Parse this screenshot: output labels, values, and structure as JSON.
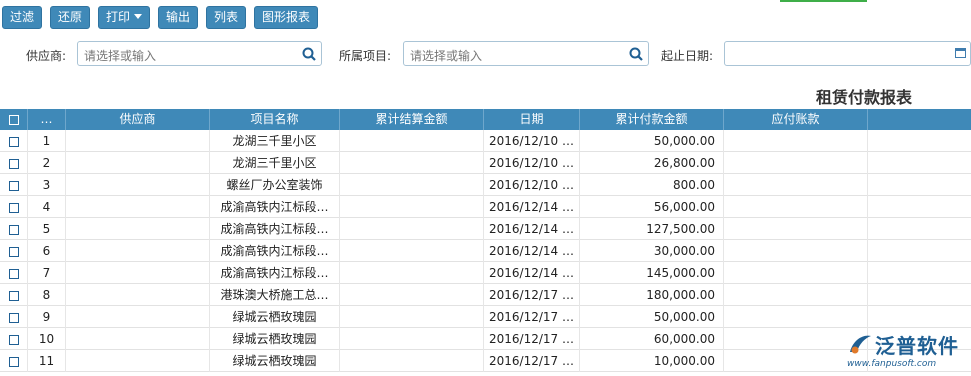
{
  "toolbar": {
    "filter_label": "过滤",
    "restore_label": "还原",
    "print_label": "打印",
    "export_label": "输出",
    "list_label": "列表",
    "chart_report_label": "图形报表"
  },
  "filters": {
    "supplier_label": "供应商:",
    "supplier_placeholder": "请选择或输入",
    "project_label": "所属项目:",
    "project_placeholder": "请选择或输入",
    "date_label": "起止日期:"
  },
  "report_title": "租赁付款报表",
  "table": {
    "headers": [
      "…",
      "供应商",
      "项目名称",
      "累计结算金额",
      "日期",
      "累计付款金额",
      "应付账款"
    ],
    "rows": [
      {
        "no": "1",
        "supplier": "",
        "project": "龙湖三千里小区",
        "settle": "",
        "date": "2016/12/10 …",
        "paid": "50,000.00",
        "payable": ""
      },
      {
        "no": "2",
        "supplier": "",
        "project": "龙湖三千里小区",
        "settle": "",
        "date": "2016/12/10 …",
        "paid": "26,800.00",
        "payable": ""
      },
      {
        "no": "3",
        "supplier": "",
        "project": "螺丝厂办公室装饰",
        "settle": "",
        "date": "2016/12/10 …",
        "paid": "800.00",
        "payable": ""
      },
      {
        "no": "4",
        "supplier": "",
        "project": "成渝高铁内江标段…",
        "settle": "",
        "date": "2016/12/14 …",
        "paid": "56,000.00",
        "payable": ""
      },
      {
        "no": "5",
        "supplier": "",
        "project": "成渝高铁内江标段…",
        "settle": "",
        "date": "2016/12/14 …",
        "paid": "127,500.00",
        "payable": ""
      },
      {
        "no": "6",
        "supplier": "",
        "project": "成渝高铁内江标段…",
        "settle": "",
        "date": "2016/12/14 …",
        "paid": "30,000.00",
        "payable": ""
      },
      {
        "no": "7",
        "supplier": "",
        "project": "成渝高铁内江标段…",
        "settle": "",
        "date": "2016/12/14 …",
        "paid": "145,000.00",
        "payable": ""
      },
      {
        "no": "8",
        "supplier": "",
        "project": "港珠澳大桥施工总…",
        "settle": "",
        "date": "2016/12/17 …",
        "paid": "180,000.00",
        "payable": ""
      },
      {
        "no": "9",
        "supplier": "",
        "project": "绿城云栖玫瑰园",
        "settle": "",
        "date": "2016/12/17 …",
        "paid": "50,000.00",
        "payable": ""
      },
      {
        "no": "10",
        "supplier": "",
        "project": "绿城云栖玫瑰园",
        "settle": "",
        "date": "2016/12/17 …",
        "paid": "60,000.00",
        "payable": ""
      },
      {
        "no": "11",
        "supplier": "",
        "project": "绿城云栖玫瑰园",
        "settle": "",
        "date": "2016/12/17 …",
        "paid": "10,000.00",
        "payable": ""
      }
    ]
  },
  "watermark": {
    "brand": "泛普软件",
    "url": "www.fanpusoft.com"
  },
  "colors": {
    "header_blue": "#3f89b8",
    "button_blue": "#3f89b8",
    "accent_green": "#3fae49",
    "logo_blue": "#1f5f93"
  }
}
